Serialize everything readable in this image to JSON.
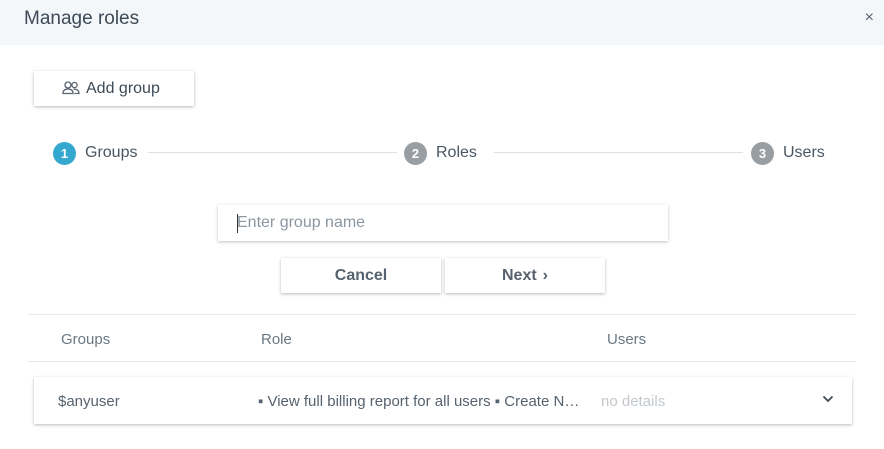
{
  "dialog": {
    "title": "Manage roles",
    "close_glyph": "×"
  },
  "toolbar": {
    "add_group_label": "Add group",
    "add_group_icon": "users-icon"
  },
  "stepper": {
    "steps": [
      {
        "number": "1",
        "label": "Groups",
        "state": "active"
      },
      {
        "number": "2",
        "label": "Roles",
        "state": "inactive"
      },
      {
        "number": "3",
        "label": "Users",
        "state": "inactive"
      }
    ]
  },
  "form": {
    "group_name": {
      "value": "",
      "placeholder": "Enter group name"
    },
    "cancel_label": "Cancel",
    "next_label": "Next",
    "next_icon": "›"
  },
  "table": {
    "headers": {
      "groups": "Groups",
      "role": "Role",
      "users": "Users"
    },
    "rows": [
      {
        "group": "$anyuser",
        "roles": "▪ View full billing report for all users ▪ Create New Resources ▪ Manage Billing",
        "users": "no details"
      }
    ]
  },
  "colors": {
    "accent": "#35a8cf",
    "inactive_step": "#999ea3",
    "header_bg": "#f4f7fa"
  }
}
